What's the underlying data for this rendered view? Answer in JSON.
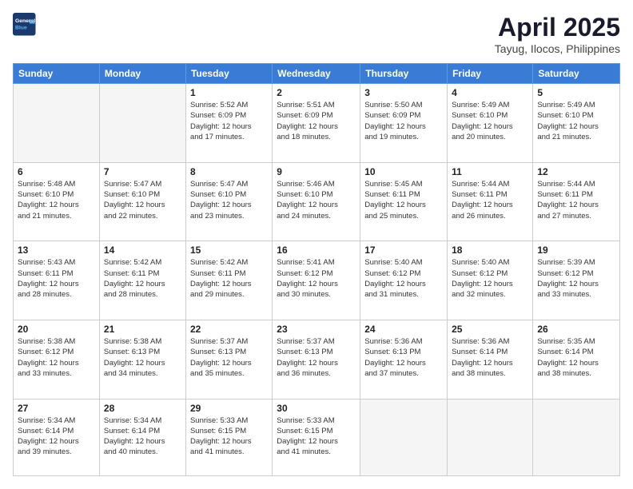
{
  "header": {
    "logo_line1": "General",
    "logo_line2": "Blue",
    "main_title": "April 2025",
    "subtitle": "Tayug, Ilocos, Philippines"
  },
  "days_of_week": [
    "Sunday",
    "Monday",
    "Tuesday",
    "Wednesday",
    "Thursday",
    "Friday",
    "Saturday"
  ],
  "weeks": [
    [
      {
        "day": "",
        "empty": true
      },
      {
        "day": "",
        "empty": true
      },
      {
        "day": "1",
        "sunrise": "5:52 AM",
        "sunset": "6:09 PM",
        "daylight": "12 hours and 17 minutes."
      },
      {
        "day": "2",
        "sunrise": "5:51 AM",
        "sunset": "6:09 PM",
        "daylight": "12 hours and 18 minutes."
      },
      {
        "day": "3",
        "sunrise": "5:50 AM",
        "sunset": "6:09 PM",
        "daylight": "12 hours and 19 minutes."
      },
      {
        "day": "4",
        "sunrise": "5:49 AM",
        "sunset": "6:10 PM",
        "daylight": "12 hours and 20 minutes."
      },
      {
        "day": "5",
        "sunrise": "5:49 AM",
        "sunset": "6:10 PM",
        "daylight": "12 hours and 21 minutes."
      }
    ],
    [
      {
        "day": "6",
        "sunrise": "5:48 AM",
        "sunset": "6:10 PM",
        "daylight": "12 hours and 21 minutes."
      },
      {
        "day": "7",
        "sunrise": "5:47 AM",
        "sunset": "6:10 PM",
        "daylight": "12 hours and 22 minutes."
      },
      {
        "day": "8",
        "sunrise": "5:47 AM",
        "sunset": "6:10 PM",
        "daylight": "12 hours and 23 minutes."
      },
      {
        "day": "9",
        "sunrise": "5:46 AM",
        "sunset": "6:10 PM",
        "daylight": "12 hours and 24 minutes."
      },
      {
        "day": "10",
        "sunrise": "5:45 AM",
        "sunset": "6:11 PM",
        "daylight": "12 hours and 25 minutes."
      },
      {
        "day": "11",
        "sunrise": "5:44 AM",
        "sunset": "6:11 PM",
        "daylight": "12 hours and 26 minutes."
      },
      {
        "day": "12",
        "sunrise": "5:44 AM",
        "sunset": "6:11 PM",
        "daylight": "12 hours and 27 minutes."
      }
    ],
    [
      {
        "day": "13",
        "sunrise": "5:43 AM",
        "sunset": "6:11 PM",
        "daylight": "12 hours and 28 minutes."
      },
      {
        "day": "14",
        "sunrise": "5:42 AM",
        "sunset": "6:11 PM",
        "daylight": "12 hours and 28 minutes."
      },
      {
        "day": "15",
        "sunrise": "5:42 AM",
        "sunset": "6:11 PM",
        "daylight": "12 hours and 29 minutes."
      },
      {
        "day": "16",
        "sunrise": "5:41 AM",
        "sunset": "6:12 PM",
        "daylight": "12 hours and 30 minutes."
      },
      {
        "day": "17",
        "sunrise": "5:40 AM",
        "sunset": "6:12 PM",
        "daylight": "12 hours and 31 minutes."
      },
      {
        "day": "18",
        "sunrise": "5:40 AM",
        "sunset": "6:12 PM",
        "daylight": "12 hours and 32 minutes."
      },
      {
        "day": "19",
        "sunrise": "5:39 AM",
        "sunset": "6:12 PM",
        "daylight": "12 hours and 33 minutes."
      }
    ],
    [
      {
        "day": "20",
        "sunrise": "5:38 AM",
        "sunset": "6:12 PM",
        "daylight": "12 hours and 33 minutes."
      },
      {
        "day": "21",
        "sunrise": "5:38 AM",
        "sunset": "6:13 PM",
        "daylight": "12 hours and 34 minutes."
      },
      {
        "day": "22",
        "sunrise": "5:37 AM",
        "sunset": "6:13 PM",
        "daylight": "12 hours and 35 minutes."
      },
      {
        "day": "23",
        "sunrise": "5:37 AM",
        "sunset": "6:13 PM",
        "daylight": "12 hours and 36 minutes."
      },
      {
        "day": "24",
        "sunrise": "5:36 AM",
        "sunset": "6:13 PM",
        "daylight": "12 hours and 37 minutes."
      },
      {
        "day": "25",
        "sunrise": "5:36 AM",
        "sunset": "6:14 PM",
        "daylight": "12 hours and 38 minutes."
      },
      {
        "day": "26",
        "sunrise": "5:35 AM",
        "sunset": "6:14 PM",
        "daylight": "12 hours and 38 minutes."
      }
    ],
    [
      {
        "day": "27",
        "sunrise": "5:34 AM",
        "sunset": "6:14 PM",
        "daylight": "12 hours and 39 minutes."
      },
      {
        "day": "28",
        "sunrise": "5:34 AM",
        "sunset": "6:14 PM",
        "daylight": "12 hours and 40 minutes."
      },
      {
        "day": "29",
        "sunrise": "5:33 AM",
        "sunset": "6:15 PM",
        "daylight": "12 hours and 41 minutes."
      },
      {
        "day": "30",
        "sunrise": "5:33 AM",
        "sunset": "6:15 PM",
        "daylight": "12 hours and 41 minutes."
      },
      {
        "day": "",
        "empty": true
      },
      {
        "day": "",
        "empty": true
      },
      {
        "day": "",
        "empty": true
      }
    ]
  ],
  "labels": {
    "sunrise_prefix": "Sunrise: ",
    "sunset_prefix": "Sunset: ",
    "daylight_prefix": "Daylight: "
  }
}
